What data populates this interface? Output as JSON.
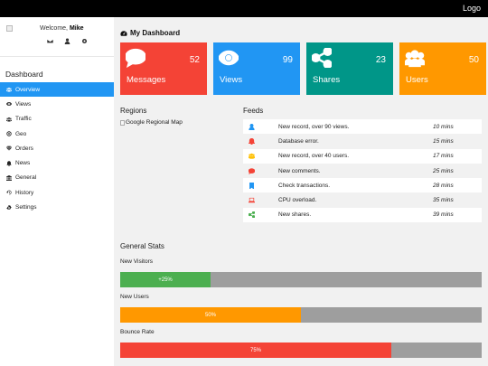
{
  "topbar": {
    "logo": "Logo"
  },
  "user": {
    "welcome_prefix": "Welcome, ",
    "name": "Mike"
  },
  "sidebar": {
    "title": "Dashboard",
    "items": [
      {
        "label": "Overview",
        "icon": "users-icon"
      },
      {
        "label": "Views",
        "icon": "eye-icon"
      },
      {
        "label": "Traffic",
        "icon": "users-icon"
      },
      {
        "label": "Geo",
        "icon": "bullseye-icon"
      },
      {
        "label": "Orders",
        "icon": "diamond-icon"
      },
      {
        "label": "News",
        "icon": "bell-icon"
      },
      {
        "label": "General",
        "icon": "bank-icon"
      },
      {
        "label": "History",
        "icon": "history-icon"
      },
      {
        "label": "Settings",
        "icon": "cog-icon"
      }
    ],
    "active_index": 0
  },
  "main": {
    "title": "My Dashboard",
    "cards": [
      {
        "label": "Messages",
        "value": "52",
        "color": "#f44336",
        "icon": "comment-icon"
      },
      {
        "label": "Views",
        "value": "99",
        "color": "#2196f3",
        "icon": "eye-icon"
      },
      {
        "label": "Shares",
        "value": "23",
        "color": "#009688",
        "icon": "share-icon"
      },
      {
        "label": "Users",
        "value": "50",
        "color": "#ff9800",
        "icon": "users-icon"
      }
    ],
    "regions": {
      "heading": "Regions",
      "map_alt": "Google Regional Map"
    },
    "feeds": {
      "heading": "Feeds",
      "items": [
        {
          "text": "New record, over 90 views.",
          "time": "10 mins",
          "icon": "user-icon",
          "icon_color": "#2196f3"
        },
        {
          "text": "Database error.",
          "time": "15 mins",
          "icon": "bell-icon",
          "icon_color": "#f44336"
        },
        {
          "text": "New record, over 40 users.",
          "time": "17 mins",
          "icon": "users-icon",
          "icon_color": "#ffc107"
        },
        {
          "text": "New comments.",
          "time": "25 mins",
          "icon": "comment-icon",
          "icon_color": "#f44336"
        },
        {
          "text": "Check transactions.",
          "time": "28 mins",
          "icon": "bookmark-icon",
          "icon_color": "#2196f3"
        },
        {
          "text": "CPU overload.",
          "time": "35 mins",
          "icon": "laptop-icon",
          "icon_color": "#f44336"
        },
        {
          "text": "New shares.",
          "time": "39 mins",
          "icon": "share-icon",
          "icon_color": "#4caf50"
        }
      ]
    },
    "general_stats": {
      "heading": "General Stats",
      "stats": [
        {
          "label": "New Visitors",
          "value_text": "+25%",
          "fraction": 0.25,
          "color": "#4caf50"
        },
        {
          "label": "New Users",
          "value_text": "50%",
          "fraction": 0.5,
          "color": "#ff9800"
        },
        {
          "label": "Bounce Rate",
          "value_text": "75%",
          "fraction": 0.75,
          "color": "#f44336"
        }
      ]
    }
  }
}
